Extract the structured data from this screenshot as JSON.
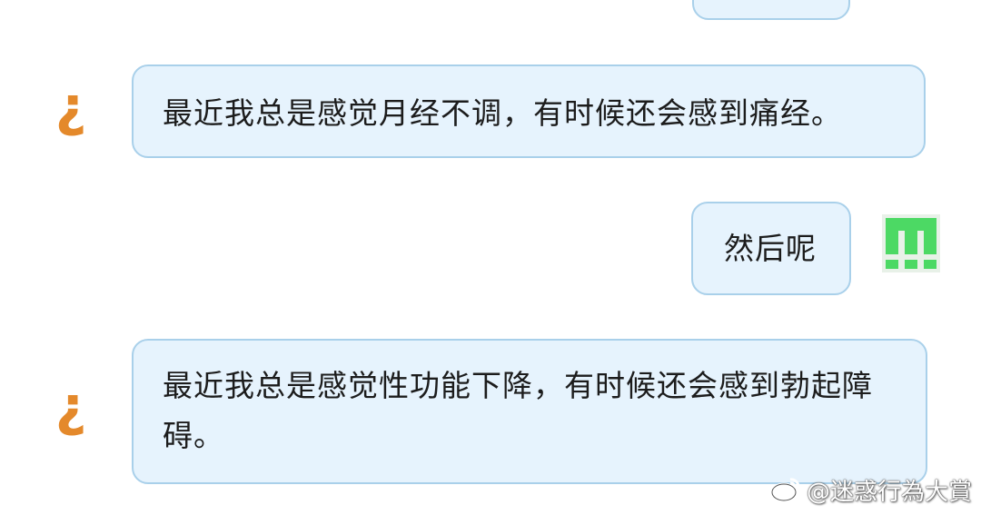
{
  "messages": [
    {
      "sender": "bot",
      "avatar_icon": "inverted-question-mark-icon",
      "avatar_glyph": "¿"
    },
    {
      "sender": "bot",
      "avatar_icon": "inverted-question-mark-icon",
      "avatar_glyph": "¿",
      "text": "最近我总是感觉月经不调，有时候还会感到痛经。"
    },
    {
      "sender": "user",
      "avatar_icon": "pixel-avatar-icon",
      "text": "然后呢"
    },
    {
      "sender": "bot",
      "avatar_icon": "inverted-question-mark-icon",
      "avatar_glyph": "¿",
      "text": "最近我总是感觉性功能下降，有时候还会感到勃起障碍。"
    }
  ],
  "watermark": {
    "icon": "weibo-logo-icon",
    "text": "@迷惑行為大賞"
  },
  "colors": {
    "bubble_fill": "#e6f3fd",
    "bubble_border": "#a9d0ea",
    "bot_avatar": "#e4892b",
    "user_avatar_green": "#4cd964",
    "user_avatar_bg": "#e8f1e8"
  }
}
